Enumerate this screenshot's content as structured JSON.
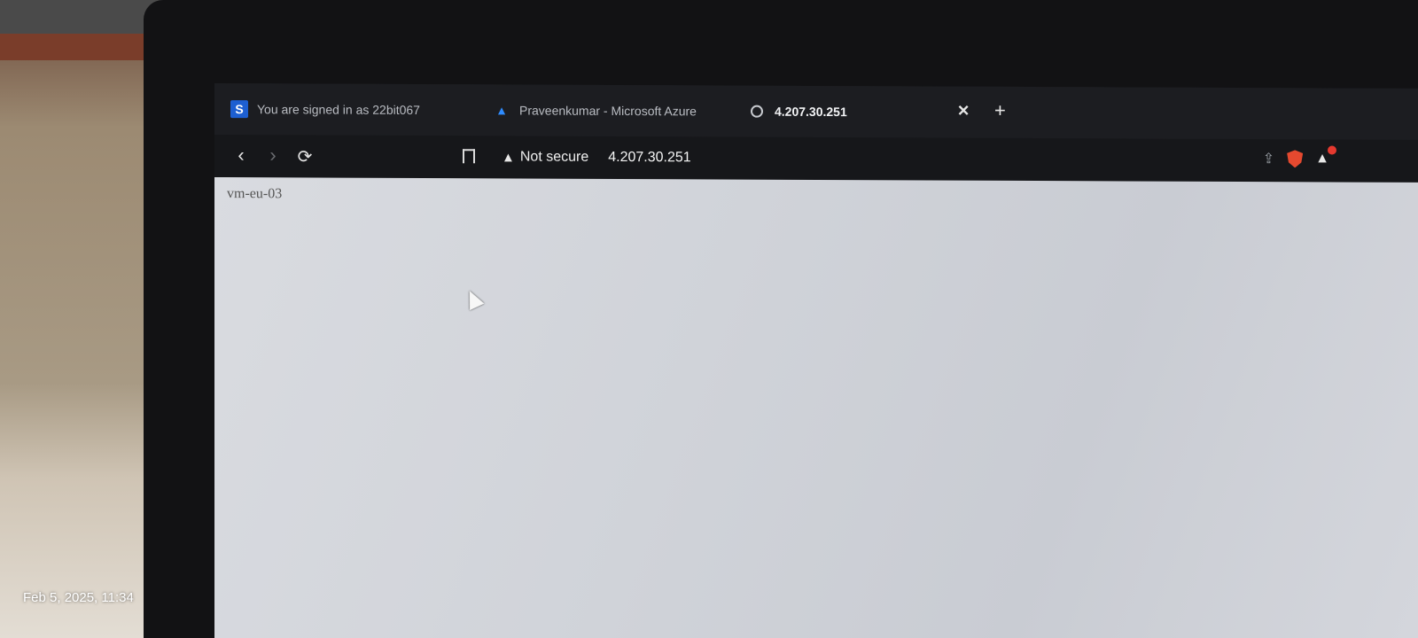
{
  "tabs": [
    {
      "label": "You are signed in as 22bit067",
      "favicon": "s-logo-icon",
      "active": false
    },
    {
      "label": "Praveenkumar - Microsoft Azure",
      "favicon": "azure-icon",
      "active": false
    },
    {
      "label": "4.207.30.251",
      "favicon": "globe-icon",
      "active": true
    }
  ],
  "toolbar": {
    "security_label": "Not secure",
    "url": "4.207.30.251"
  },
  "page": {
    "body_text": "vm-eu-03"
  },
  "photo": {
    "timestamp": "Feb 5, 2025, 11:34"
  },
  "colors": {
    "brave_accent": "#e5492f",
    "azure_blue": "#2f8cff",
    "tab_favicon_blue": "#1d5fd1"
  }
}
